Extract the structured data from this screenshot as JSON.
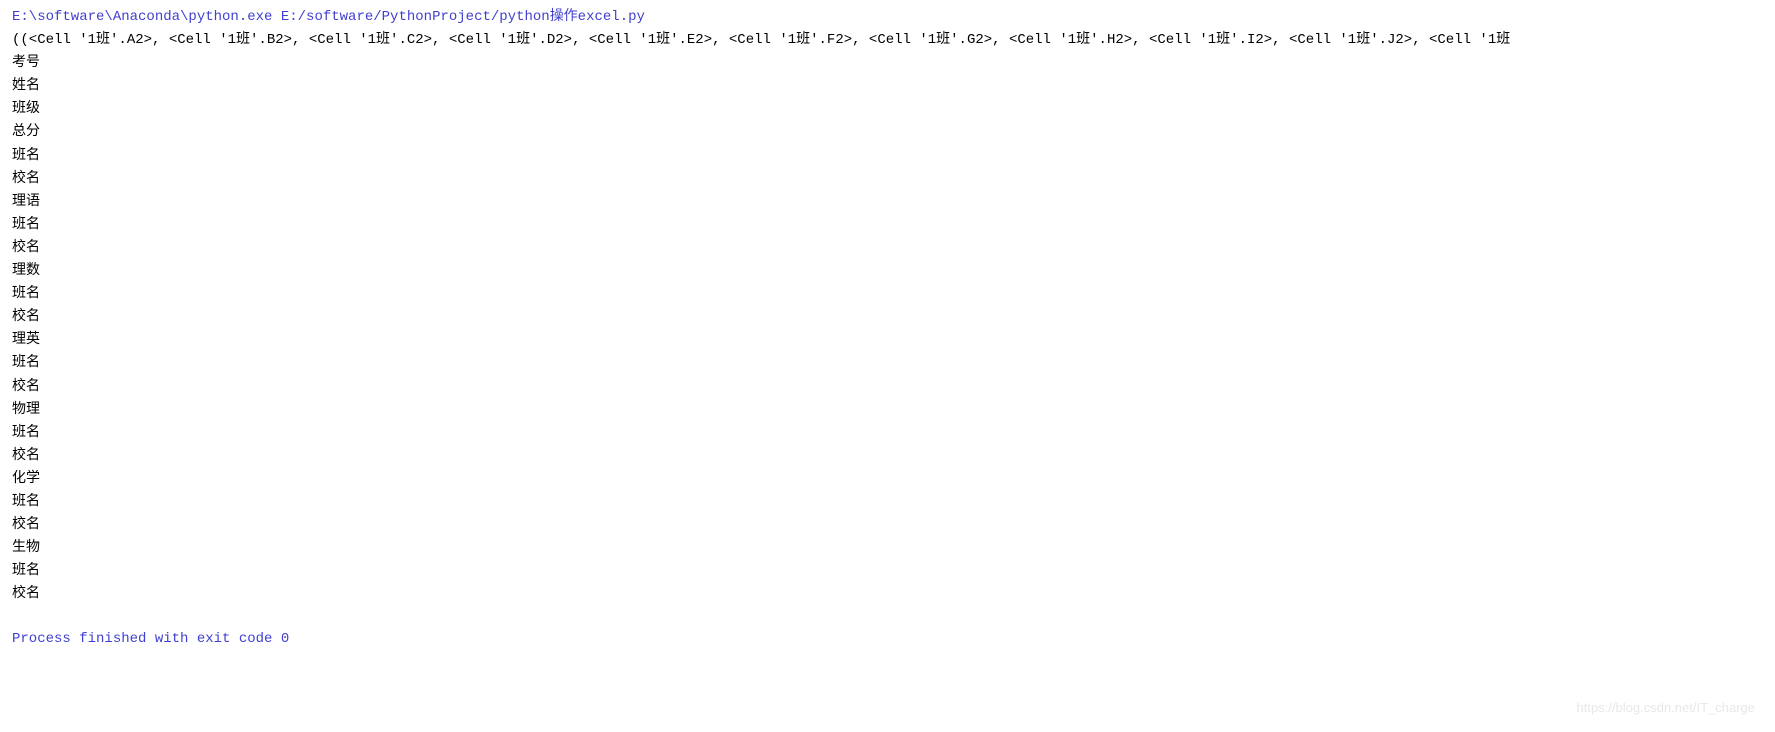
{
  "command": "E:\\software\\Anaconda\\python.exe E:/software/PythonProject/python操作excel.py",
  "cell_tuple": "((<Cell '1班'.A2>, <Cell '1班'.B2>, <Cell '1班'.C2>, <Cell '1班'.D2>, <Cell '1班'.E2>, <Cell '1班'.F2>, <Cell '1班'.G2>, <Cell '1班'.H2>, <Cell '1班'.I2>, <Cell '1班'.J2>, <Cell '1班",
  "output_lines": [
    "考号",
    "姓名",
    "班级",
    "总分",
    "班名",
    "校名",
    "理语",
    "班名",
    "校名",
    "理数",
    "班名",
    "校名",
    "理英",
    "班名",
    "校名",
    "物理",
    "班名",
    "校名",
    "化学",
    "班名",
    "校名",
    "生物",
    "班名",
    "校名"
  ],
  "process_exit": "Process finished with exit code 0",
  "watermark": "https://blog.csdn.net/IT_charge"
}
